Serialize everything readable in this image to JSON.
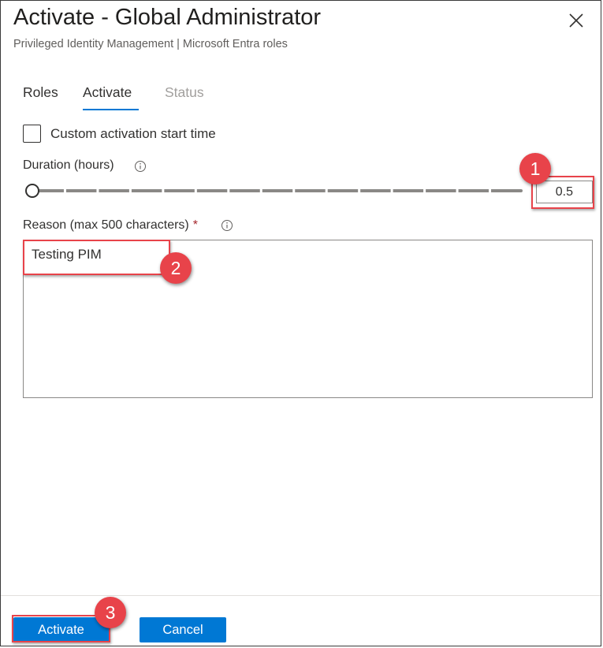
{
  "panel": {
    "title": "Activate - Global Administrator",
    "subtitle": "Privileged Identity Management | Microsoft Entra roles"
  },
  "tabs": [
    {
      "label": "Roles",
      "state": "default"
    },
    {
      "label": "Activate",
      "state": "selected"
    },
    {
      "label": "Status",
      "state": "disabled"
    }
  ],
  "form": {
    "custom_start_label": "Custom activation start time",
    "custom_start_checked": false,
    "duration_label": "Duration (hours)",
    "duration_value": "0.5",
    "reason_label": "Reason (max 500 characters)",
    "reason_required_mark": "*",
    "reason_value": "Testing PIM"
  },
  "footer": {
    "activate_label": "Activate",
    "cancel_label": "Cancel"
  },
  "annotations": [
    {
      "number": "1",
      "target": "duration-input"
    },
    {
      "number": "2",
      "target": "reason-text"
    },
    {
      "number": "3",
      "target": "activate-button"
    }
  ],
  "colors": {
    "accent": "#0078d4",
    "annotation_red": "#e8434a"
  },
  "icons": [
    "close-icon",
    "info-icon"
  ]
}
